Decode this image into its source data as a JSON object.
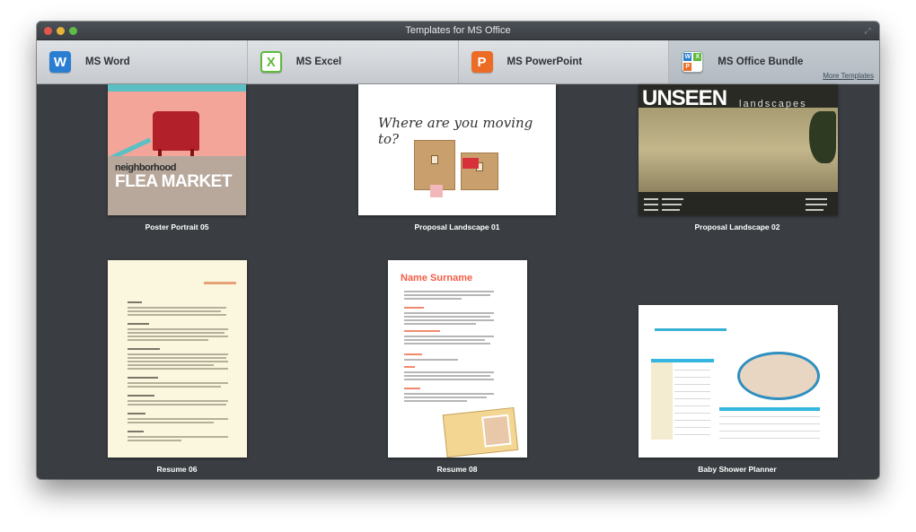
{
  "window": {
    "title": "Templates for MS Office",
    "expand_glyph": "⤢"
  },
  "tabs": [
    {
      "label": "MS Word",
      "icon": "word-icon",
      "glyph": "W"
    },
    {
      "label": "MS Excel",
      "icon": "excel-icon",
      "glyph": "X"
    },
    {
      "label": "MS PowerPoint",
      "icon": "powerpoint-icon",
      "glyph": "P"
    },
    {
      "label": "MS Office Bundle",
      "icon": "office-bundle-icon",
      "glyph": ""
    }
  ],
  "more_templates": "More Templates",
  "templates": [
    {
      "caption": "Poster Portrait 05",
      "line1": "neighborhood",
      "line2": "FLEA MARKET"
    },
    {
      "caption": "Proposal Landscape 01",
      "headline": "Where are you moving to?"
    },
    {
      "caption": "Proposal Landscape 02",
      "headline": "UNSEEN",
      "sub": "landscapes"
    },
    {
      "caption": "Resume 06"
    },
    {
      "caption": "Resume 08",
      "name": "Name Surname"
    },
    {
      "caption": "Baby Shower Planner"
    }
  ],
  "colors": {
    "window_bg": "#3a3e43",
    "tab_bar": "#d4d8dc",
    "accent_red": "#f25d45",
    "accent_blue": "#33b6df"
  }
}
